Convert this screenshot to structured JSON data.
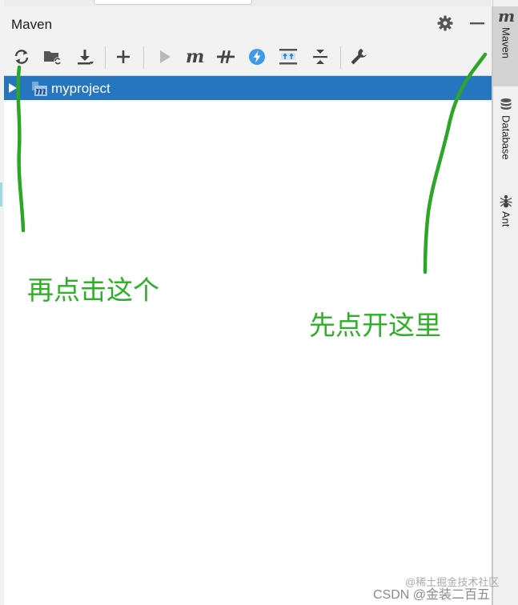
{
  "panel": {
    "title": "Maven"
  },
  "toolbar": {
    "items": [
      {
        "name": "reload-icon"
      },
      {
        "name": "generate-sources-icon"
      },
      {
        "name": "download-icon"
      },
      {
        "name": "add-icon"
      },
      {
        "name": "run-icon"
      },
      {
        "name": "execute-goal-icon"
      },
      {
        "name": "toggle-offline-icon"
      },
      {
        "name": "skip-tests-icon"
      },
      {
        "name": "show-dependencies-icon"
      },
      {
        "name": "collapse-all-icon"
      },
      {
        "name": "settings-wrench-icon"
      }
    ]
  },
  "tree": {
    "items": [
      {
        "label": "myproject",
        "selected": true
      }
    ]
  },
  "sidebar": {
    "tabs": [
      {
        "label": "Maven",
        "active": true
      },
      {
        "label": "Database"
      },
      {
        "label": "Ant"
      }
    ]
  },
  "annotations": {
    "left_note": "再点击这个",
    "right_note": "先点开这里"
  },
  "watermark": {
    "main": "CSDN @金装二百五",
    "faint": "@稀土掘金技术社区"
  },
  "colors": {
    "selection": "#2675bf",
    "annotation": "#2db026",
    "accent_blue": "#3d9be9"
  }
}
